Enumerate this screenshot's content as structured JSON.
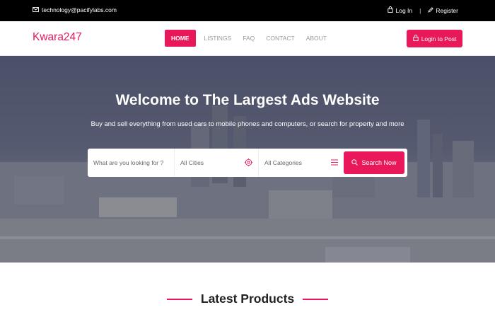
{
  "topbar": {
    "email": "technology@pacifylabs.com",
    "login": "Log In",
    "separator": "|",
    "register": "Register"
  },
  "navbar": {
    "logo": "Kwara247",
    "items": [
      "HOME",
      "LISTINGS",
      "FAQ",
      "CONTACT",
      "ABOUT"
    ],
    "active_item": "HOME",
    "login_to_post": "Login to Post"
  },
  "hero": {
    "title": "Welcome to The Largest Ads Website",
    "subtitle": "Buy and sell everything from used cars to mobile phones and computers, or search for property and more"
  },
  "search": {
    "placeholder": "What are you looking for ?",
    "city_value": "All Cities",
    "category_value": "All Categories",
    "button": "Search Now"
  },
  "section": {
    "title": "Latest Products"
  },
  "colors": {
    "accent": "#e8185a",
    "topbar": "#000000"
  }
}
